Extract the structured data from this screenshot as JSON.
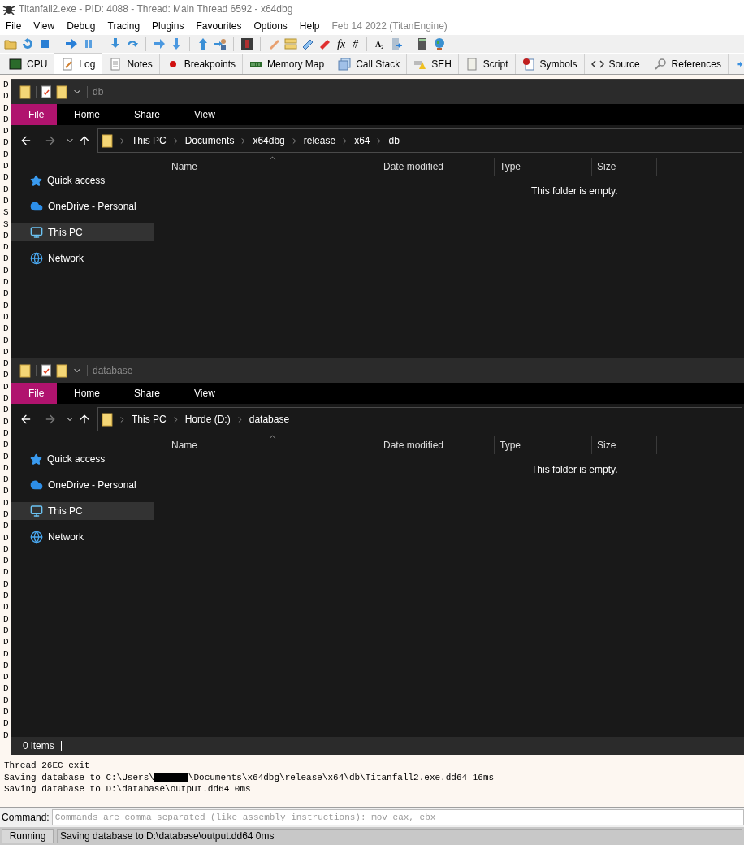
{
  "window": {
    "title": "Titanfall2.exe - PID: 4088 - Thread: Main Thread 6592 - x64dbg"
  },
  "menu": [
    {
      "label": "File"
    },
    {
      "label": "View"
    },
    {
      "label": "Debug"
    },
    {
      "label": "Tracing"
    },
    {
      "label": "Plugins"
    },
    {
      "label": "Favourites"
    },
    {
      "label": "Options"
    },
    {
      "label": "Help"
    }
  ],
  "build_info": "Feb 14 2022 (TitanEngine)",
  "toolbar_glyphs": [
    "fx",
    "#",
    "A₂"
  ],
  "tabs": [
    {
      "label": "CPU",
      "selected": false
    },
    {
      "label": "Log",
      "selected": true
    },
    {
      "label": "Notes",
      "selected": false
    },
    {
      "label": "Breakpoints",
      "selected": false
    },
    {
      "label": "Memory Map",
      "selected": false
    },
    {
      "label": "Call Stack",
      "selected": false
    },
    {
      "label": "SEH",
      "selected": false
    },
    {
      "label": "Script",
      "selected": false
    },
    {
      "label": "Symbols",
      "selected": false
    },
    {
      "label": "Source",
      "selected": false
    },
    {
      "label": "References",
      "selected": false
    }
  ],
  "log": {
    "fragments": [
      "D",
      "D",
      "D",
      "D",
      "D",
      "D",
      "D",
      "D",
      "D",
      "D",
      "D",
      "S",
      "S",
      "D",
      "D",
      "D",
      "D",
      "D",
      "D",
      "D",
      "D",
      "D",
      "D",
      "D",
      "D",
      "D",
      "D",
      "D",
      "D",
      "D",
      "D",
      "D",
      "D",
      "D",
      "D",
      "D",
      "D",
      "D",
      "D",
      "D",
      "D",
      "D",
      "D",
      "D",
      "D",
      "D",
      "D",
      "D",
      "D",
      "D",
      "D",
      "D",
      "D",
      "D",
      "D",
      "D",
      "D"
    ],
    "lines": [
      {
        "before": "Thread 26EC exit",
        "redacted": false
      },
      {
        "before": "Saving database to C:\\Users\\",
        "redacted": true,
        "after": "\\Documents\\x64dbg\\release\\x64\\db\\Titanfall2.exe.dd64 16ms"
      },
      {
        "before": "Saving database to D:\\database\\output.dd64 0ms",
        "redacted": false
      }
    ]
  },
  "explorer_windows": [
    {
      "title": "db",
      "ribbon_tabs": [
        {
          "label": "File",
          "selected": true
        },
        {
          "label": "Home",
          "selected": false
        },
        {
          "label": "Share",
          "selected": false
        },
        {
          "label": "View",
          "selected": false
        }
      ],
      "path": [
        "This PC",
        "Documents",
        "x64dbg",
        "release",
        "x64",
        "db"
      ],
      "nav": [
        {
          "label": "Quick access",
          "kind": "star",
          "selected": false
        },
        {
          "label": "OneDrive - Personal",
          "kind": "cloud",
          "selected": false
        },
        {
          "label": "This PC",
          "kind": "pc",
          "selected": true
        },
        {
          "label": "Network",
          "kind": "network",
          "selected": false
        }
      ],
      "columns": [
        "Name",
        "Date modified",
        "Type",
        "Size"
      ],
      "empty_message": "This folder is empty."
    },
    {
      "title": "database",
      "ribbon_tabs": [
        {
          "label": "File",
          "selected": true
        },
        {
          "label": "Home",
          "selected": false
        },
        {
          "label": "Share",
          "selected": false
        },
        {
          "label": "View",
          "selected": false
        }
      ],
      "path": [
        "This PC",
        "Horde (D:)",
        "database"
      ],
      "nav": [
        {
          "label": "Quick access",
          "kind": "star",
          "selected": false
        },
        {
          "label": "OneDrive - Personal",
          "kind": "cloud",
          "selected": false
        },
        {
          "label": "This PC",
          "kind": "pc",
          "selected": true
        },
        {
          "label": "Network",
          "kind": "network",
          "selected": false
        }
      ],
      "columns": [
        "Name",
        "Date modified",
        "Type",
        "Size"
      ],
      "empty_message": "This folder is empty.",
      "status": "0 items"
    }
  ],
  "command": {
    "label": "Command:",
    "placeholder": "Commands are comma separated (like assembly instructions): mov eax, ebx"
  },
  "status_bar": {
    "state": "Running",
    "message": "Saving database to D:\\database\\output.dd64 0ms"
  }
}
